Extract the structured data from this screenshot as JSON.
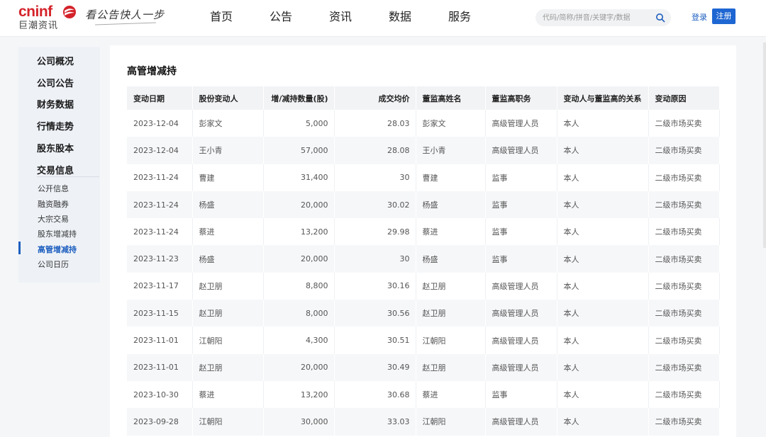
{
  "header": {
    "logo_word": "cninf",
    "logo_cn": "巨潮资讯",
    "slogan": "看公告快人一步",
    "nav": [
      "首页",
      "公告",
      "资讯",
      "数据",
      "服务"
    ],
    "search_placeholder": "代码/简称/拼音/关键字/数据",
    "login": "登录",
    "register": "注册"
  },
  "sidebar": {
    "sections": [
      "公司概况",
      "公司公告",
      "财务数据",
      "行情走势",
      "股东股本",
      "交易信息"
    ],
    "sub_items": [
      "公开信息",
      "融资融券",
      "大宗交易",
      "股东增减持",
      "高管增减持",
      "公司日历"
    ],
    "active_sub": "高管增减持"
  },
  "main": {
    "title": "高管增减持",
    "columns": [
      "变动日期",
      "股份变动人",
      "增/减持数量(股)",
      "成交均价",
      "董监高姓名",
      "董监高职务",
      "变动人与董监高的关系",
      "变动原因"
    ],
    "rows": [
      [
        "2023-12-04",
        "彭家文",
        "5,000",
        "28.03",
        "彭家文",
        "高级管理人员",
        "本人",
        "二级市场买卖"
      ],
      [
        "2023-12-04",
        "王小青",
        "57,000",
        "28.08",
        "王小青",
        "高级管理人员",
        "本人",
        "二级市场买卖"
      ],
      [
        "2023-11-24",
        "曹建",
        "31,400",
        "30",
        "曹建",
        "监事",
        "本人",
        "二级市场买卖"
      ],
      [
        "2023-11-24",
        "杨盛",
        "20,000",
        "30.02",
        "杨盛",
        "监事",
        "本人",
        "二级市场买卖"
      ],
      [
        "2023-11-24",
        "蔡进",
        "13,200",
        "29.98",
        "蔡进",
        "监事",
        "本人",
        "二级市场买卖"
      ],
      [
        "2023-11-23",
        "杨盛",
        "20,000",
        "30",
        "杨盛",
        "监事",
        "本人",
        "二级市场买卖"
      ],
      [
        "2023-11-17",
        "赵卫朋",
        "8,800",
        "30.16",
        "赵卫朋",
        "高级管理人员",
        "本人",
        "二级市场买卖"
      ],
      [
        "2023-11-15",
        "赵卫朋",
        "8,000",
        "30.56",
        "赵卫朋",
        "高级管理人员",
        "本人",
        "二级市场买卖"
      ],
      [
        "2023-11-01",
        "江朝阳",
        "4,300",
        "30.51",
        "江朝阳",
        "高级管理人员",
        "本人",
        "二级市场买卖"
      ],
      [
        "2023-11-01",
        "赵卫朋",
        "20,000",
        "30.49",
        "赵卫朋",
        "高级管理人员",
        "本人",
        "二级市场买卖"
      ],
      [
        "2023-10-30",
        "蔡进",
        "13,200",
        "30.68",
        "蔡进",
        "监事",
        "本人",
        "二级市场买卖"
      ],
      [
        "2023-09-28",
        "江朝阳",
        "30,000",
        "33.03",
        "江朝阳",
        "高级管理人员",
        "本人",
        "二级市场买卖"
      ]
    ]
  },
  "colors": {
    "brand_red": "#d4232a",
    "link_blue": "#1e5fbf",
    "register_blue": "#1e66d2"
  }
}
